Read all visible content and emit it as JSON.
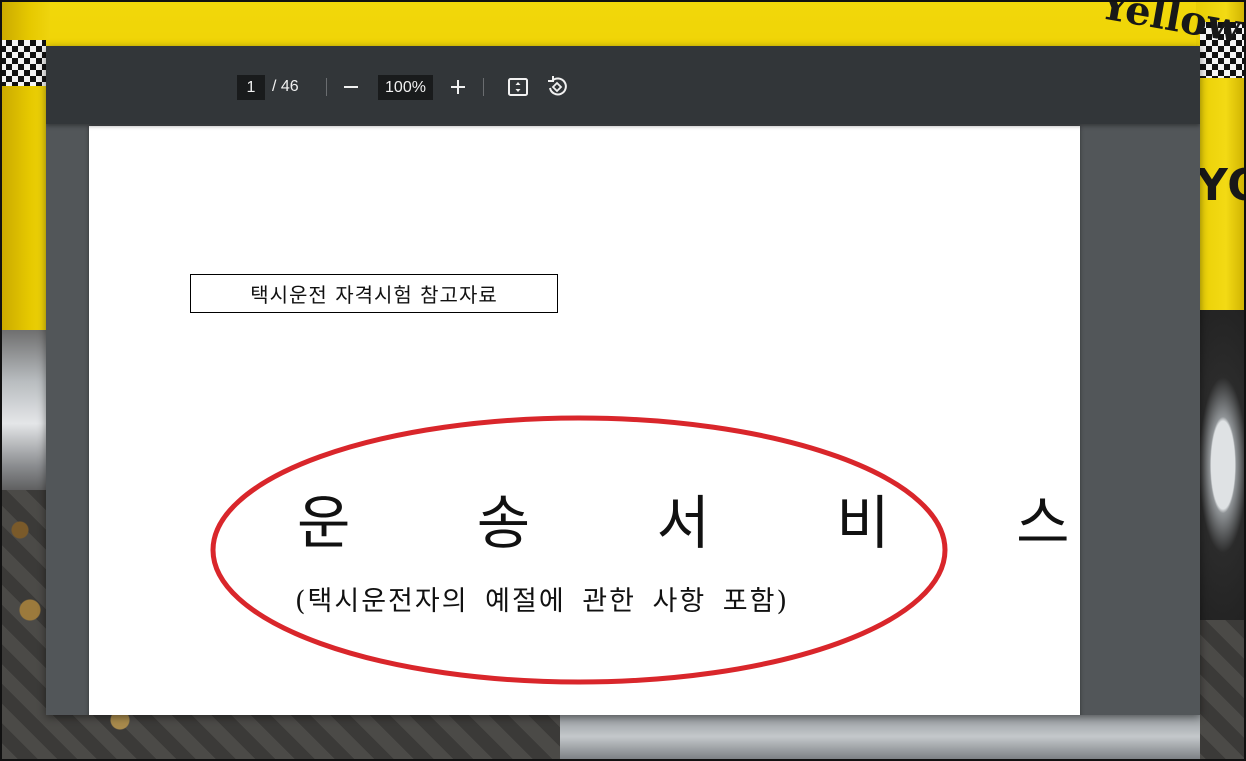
{
  "toolbar": {
    "current_page": "1",
    "page_total": "/ 46",
    "zoom_value": "100%",
    "icons": {
      "zoom_out": "minus-icon",
      "zoom_in": "plus-icon",
      "fit": "fit-to-page-icon",
      "rotate": "rotate-counterclockwise-icon"
    }
  },
  "document": {
    "reference_label": "택시운전 자격시험 참고자료",
    "title": "운 송 서 비 스",
    "subtitle": "(택시운전자의 예절에 관한 사항 포함)",
    "annotation_color": "#d9262b"
  },
  "background": {
    "taxi_text_top": "Yellow Ca",
    "taxi_text_side": "YORK"
  },
  "colors": {
    "toolbar_bg": "#323639",
    "viewer_bg": "#525659",
    "input_bg": "#191b1c",
    "toolbar_text": "#f1f1f1"
  }
}
